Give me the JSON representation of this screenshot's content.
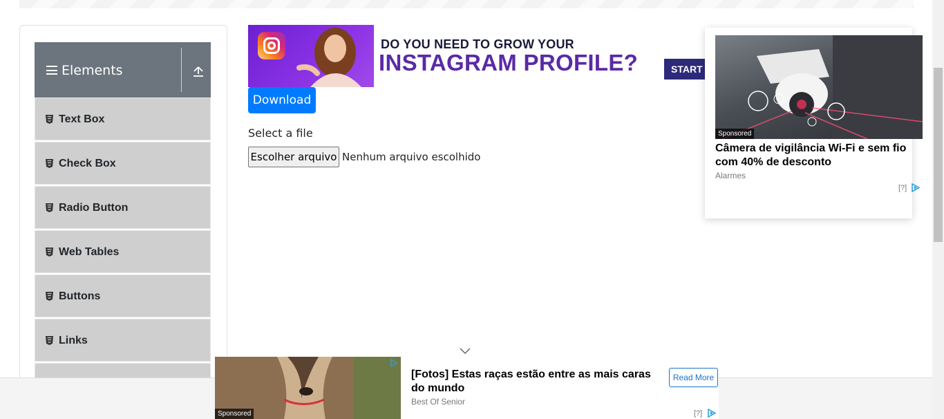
{
  "sidebar": {
    "group_title": "Elements",
    "items": [
      {
        "label": "Text Box"
      },
      {
        "label": "Check Box"
      },
      {
        "label": "Radio Button"
      },
      {
        "label": "Web Tables"
      },
      {
        "label": "Buttons"
      },
      {
        "label": "Links"
      }
    ]
  },
  "top_ad": {
    "line1": "DO YOU NEED TO GROW YOUR",
    "line2": "INSTAGRAM PROFILE?",
    "cta": "START"
  },
  "main": {
    "download_label": "Download",
    "select_label": "Select a file",
    "file_button_label": "Escolher arquivo",
    "file_status": "Nenhum arquivo escolhido"
  },
  "side_ad": {
    "sponsored": "Sponsored",
    "headline": "Câmera de vigilância Wi-Fi e sem fio com 40% de desconto",
    "source": "Alarmes",
    "info": "[?]"
  },
  "bottom_ad": {
    "sponsored": "Sponsored",
    "headline": "[Fotos] Estas raças estão entre as mais caras do mundo",
    "source": "Best Of Senior",
    "read_more": "Read More",
    "info": "[?]"
  },
  "colors": {
    "primary_button": "#007bff",
    "group_header": "#6c757d",
    "menu_item": "#cfcfcf",
    "instagram_purple": "#5a2aa6"
  }
}
